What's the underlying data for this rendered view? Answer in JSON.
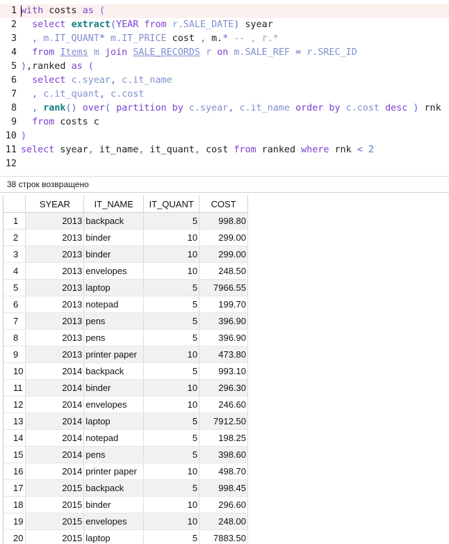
{
  "editor": {
    "lines": [
      {
        "n": "1",
        "html": "<span class=\"kw\">with</span> costs <span class=\"kw\">as</span> <span class=\"op\">(</span>"
      },
      {
        "n": "2",
        "html": "  <span class=\"kw\">select</span> <span class=\"fn\">extract</span><span class=\"op\">(</span><span class=\"kw\">YEAR</span> <span class=\"kw\">from</span> <span class=\"col\">r.SALE_DATE</span><span class=\"op\">)</span> syear"
      },
      {
        "n": "3",
        "html": "  <span class=\"op\">,</span> <span class=\"col\">m.IT_QUANT</span><span class=\"op\">*</span> <span class=\"col\">m.IT_PRICE</span> cost <span class=\"op\">,</span> m.<span class=\"op\">*</span> <span class=\"cm\">-- , r.*</span>"
      },
      {
        "n": "4",
        "html": "  <span class=\"kw\">from</span> <span class=\"tbl\">Items</span> <span class=\"col\">m</span> <span class=\"kw\">join</span> <span class=\"tbl\">SALE_RECORDS</span> <span class=\"col\">r</span> <span class=\"kw\">on</span> <span class=\"col\">m.SALE_REF</span> <span class=\"op\">=</span> <span class=\"col\">r.SREC_ID</span>"
      },
      {
        "n": "5",
        "html": "<span class=\"op\">)</span>,ranked <span class=\"kw\">as</span> <span class=\"op\">(</span>"
      },
      {
        "n": "6",
        "html": "  <span class=\"kw\">select</span> <span class=\"col\">c.syear</span><span class=\"op\">,</span> <span class=\"col\">c.it_name</span>"
      },
      {
        "n": "7",
        "html": "  <span class=\"op\">,</span> <span class=\"col\">c.it_quant</span><span class=\"op\">,</span> <span class=\"col\">c.cost</span>"
      },
      {
        "n": "8",
        "html": "  <span class=\"op\">,</span> <span class=\"fn\">rank</span><span class=\"op\">()</span> <span class=\"kw\">over</span><span class=\"op\">(</span> <span class=\"kw\">partition by</span> <span class=\"col\">c.syear</span><span class=\"op\">,</span> <span class=\"col\">c.it_name</span> <span class=\"kw\">order by</span> <span class=\"col\">c.cost</span> <span class=\"kw\">desc</span> <span class=\"op\">)</span> rnk"
      },
      {
        "n": "9",
        "html": "  <span class=\"kw\">from</span> costs c"
      },
      {
        "n": "10",
        "html": "<span class=\"op\">)</span>"
      },
      {
        "n": "11",
        "html": "<span class=\"kw\">select</span> syear<span class=\"op\">,</span> it_name<span class=\"op\">,</span> it_quant<span class=\"op\">,</span> cost <span class=\"kw\">from</span> ranked <span class=\"kw\">where</span> rnk <span class=\"op\">&lt;</span> <span class=\"num\">2</span>"
      },
      {
        "n": "12",
        "html": ""
      }
    ]
  },
  "status": {
    "text": "38 строк возвращено"
  },
  "grid": {
    "columns": [
      "",
      "SYEAR",
      "IT_NAME",
      "IT_QUANT",
      "COST"
    ],
    "rows": [
      [
        "1",
        "2013",
        "backpack",
        "5",
        "998.80"
      ],
      [
        "2",
        "2013",
        "binder",
        "10",
        "299.00"
      ],
      [
        "3",
        "2013",
        "binder",
        "10",
        "299.00"
      ],
      [
        "4",
        "2013",
        "envelopes",
        "10",
        "248.50"
      ],
      [
        "5",
        "2013",
        "laptop",
        "5",
        "7966.55"
      ],
      [
        "6",
        "2013",
        "notepad",
        "5",
        "199.70"
      ],
      [
        "7",
        "2013",
        "pens",
        "5",
        "396.90"
      ],
      [
        "8",
        "2013",
        "pens",
        "5",
        "396.90"
      ],
      [
        "9",
        "2013",
        "printer paper",
        "10",
        "473.80"
      ],
      [
        "10",
        "2014",
        "backpack",
        "5",
        "993.10"
      ],
      [
        "11",
        "2014",
        "binder",
        "10",
        "296.30"
      ],
      [
        "12",
        "2014",
        "envelopes",
        "10",
        "246.60"
      ],
      [
        "13",
        "2014",
        "laptop",
        "5",
        "7912.50"
      ],
      [
        "14",
        "2014",
        "notepad",
        "5",
        "198.25"
      ],
      [
        "15",
        "2014",
        "pens",
        "5",
        "398.60"
      ],
      [
        "16",
        "2014",
        "printer paper",
        "10",
        "498.70"
      ],
      [
        "17",
        "2015",
        "backpack",
        "5",
        "998.45"
      ],
      [
        "18",
        "2015",
        "binder",
        "10",
        "296.60"
      ],
      [
        "19",
        "2015",
        "envelopes",
        "10",
        "248.00"
      ],
      [
        "20",
        "2015",
        "laptop",
        "5",
        "7883.50"
      ]
    ]
  }
}
